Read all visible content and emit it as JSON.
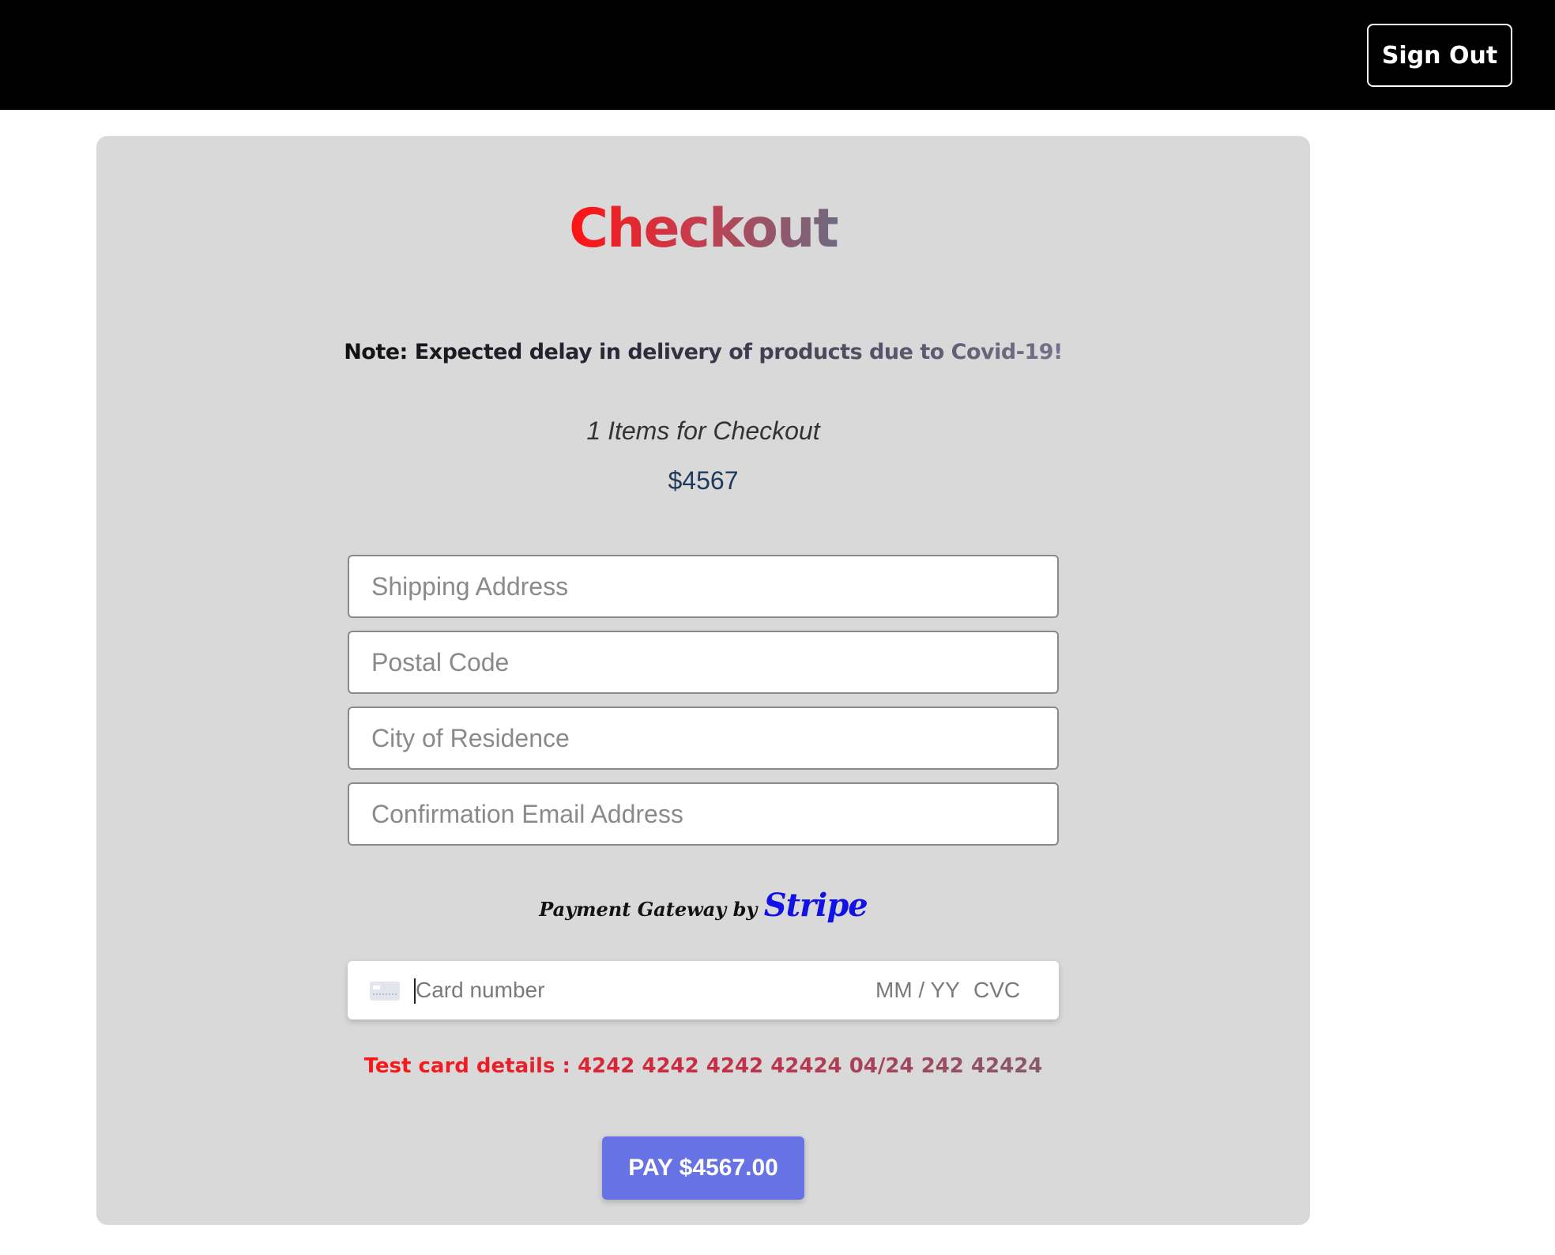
{
  "header": {
    "signout_label": "Sign Out"
  },
  "checkout": {
    "title": "Checkout",
    "note": "Note: Expected delay in delivery of products due to Covid-19!",
    "items_text": "1 Items for Checkout",
    "total": "$4567"
  },
  "form": {
    "shipping_placeholder": "Shipping Address",
    "postal_placeholder": "Postal Code",
    "city_placeholder": "City of Residence",
    "email_placeholder": "Confirmation Email Address"
  },
  "payment": {
    "gateway_prefix": "Payment Gateway by",
    "gateway_brand": "Stripe",
    "card_number_placeholder": "Card number",
    "expiry_placeholder": "MM / YY",
    "cvc_placeholder": "CVC",
    "test_card_text": "Test card details : 4242 4242 4242 42424 04/24 242 42424",
    "pay_label": "PAY $4567.00",
    "pay_button_color": "#6772e5",
    "card_icon": "credit-card-icon"
  },
  "colors": {
    "topbar": "#000000",
    "panel": "#d9d9d9",
    "title_gradient_start": "#ff1212",
    "title_gradient_end": "#6e6a80",
    "stripe_brand": "#1212e8"
  }
}
